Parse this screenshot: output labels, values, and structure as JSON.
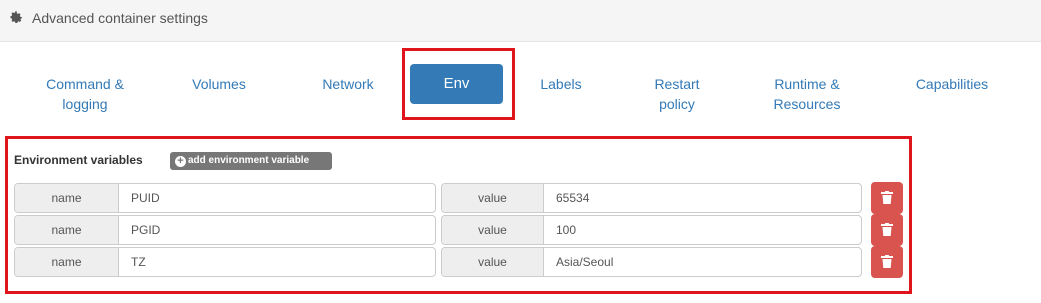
{
  "header": {
    "title": "Advanced container settings",
    "icon": "gear-icon"
  },
  "tabs": [
    {
      "label_1": "Command &",
      "label_2": "logging"
    },
    {
      "label_1": "Volumes"
    },
    {
      "label_1": "Network"
    },
    {
      "label_1": "Env",
      "active": true
    },
    {
      "label_1": "Labels"
    },
    {
      "label_1": "Restart",
      "label_2": "policy"
    },
    {
      "label_1": "Runtime &",
      "label_2": "Resources"
    },
    {
      "label_1": "Capabilities"
    }
  ],
  "env": {
    "title": "Environment variables",
    "add_label": "add environment variable",
    "name_addon": "name",
    "value_addon": "value",
    "rows": [
      {
        "name": "PUID",
        "value": "65534"
      },
      {
        "name": "PGID",
        "value": "100"
      },
      {
        "name": "TZ",
        "value": "Asia/Seoul"
      }
    ]
  },
  "colors": {
    "accent": "#337ab7",
    "danger": "#d9534f",
    "highlight": "#e0141c"
  }
}
